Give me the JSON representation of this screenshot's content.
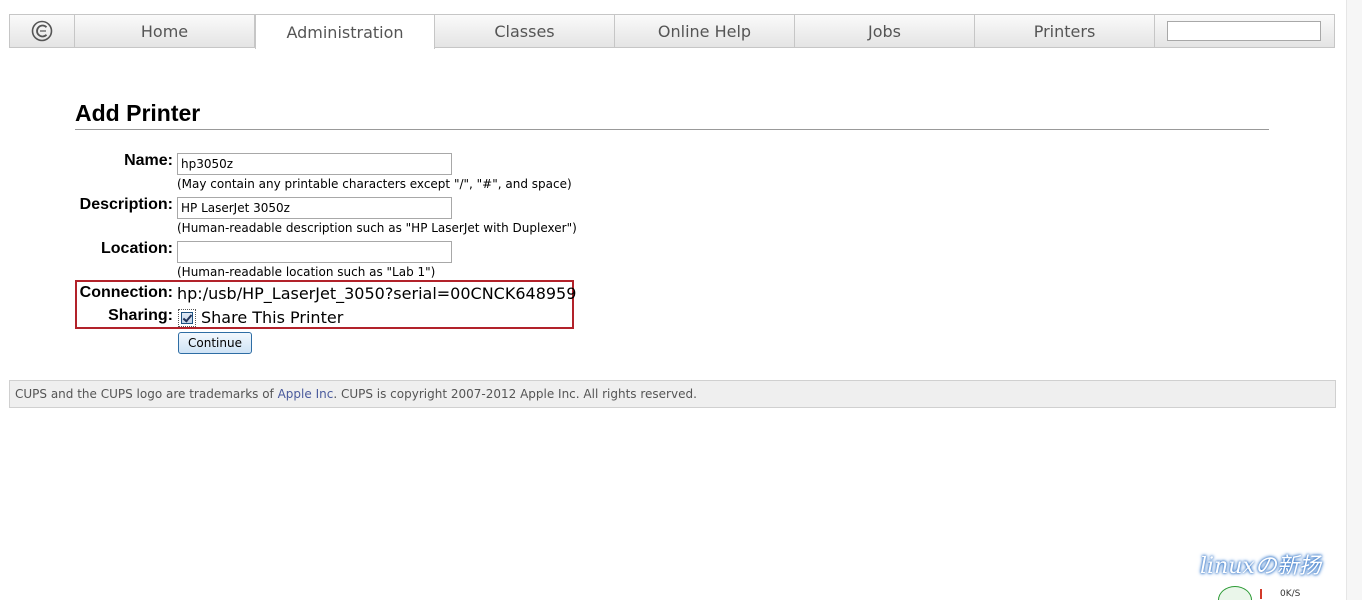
{
  "nav": {
    "logo_icon": "cups-logo-icon",
    "tabs": [
      {
        "label": "Home",
        "active": false
      },
      {
        "label": "Administration",
        "active": true
      },
      {
        "label": "Classes",
        "active": false
      },
      {
        "label": "Online Help",
        "active": false
      },
      {
        "label": "Jobs",
        "active": false
      },
      {
        "label": "Printers",
        "active": false
      }
    ],
    "search": {
      "value": "",
      "placeholder": ""
    }
  },
  "page": {
    "title": "Add Printer"
  },
  "form": {
    "name": {
      "label": "Name:",
      "value": "hp3050z",
      "hint": "(May contain any printable characters except \"/\", \"#\", and space)"
    },
    "description": {
      "label": "Description:",
      "value": "HP LaserJet 3050z",
      "hint": "(Human-readable description such as \"HP LaserJet with Duplexer\")"
    },
    "location": {
      "label": "Location:",
      "value": "",
      "hint": "(Human-readable location such as \"Lab 1\")"
    },
    "connection": {
      "label": "Connection:",
      "value": "hp:/usb/HP_LaserJet_3050?serial=00CNCK648959"
    },
    "sharing": {
      "label": "Sharing:",
      "checked": true,
      "option_label": "Share This Printer"
    },
    "continue_label": "Continue",
    "highlight_color": "#b2222a"
  },
  "footer": {
    "prefix": "CUPS and the CUPS logo are trademarks of ",
    "link": "Apple Inc",
    "suffix": ". CUPS is copyright 2007-2012 Apple Inc. All rights reserved."
  },
  "overlay": {
    "watermark": "linuxの新扬",
    "speed": "0K/S"
  }
}
